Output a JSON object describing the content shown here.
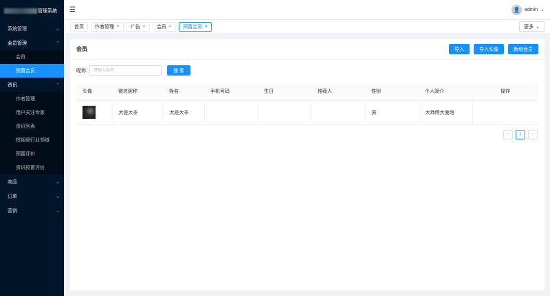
{
  "app": {
    "title_visible": "管理系统"
  },
  "sidebar": {
    "groups": [
      {
        "label": "系统管理",
        "open": false,
        "items": []
      },
      {
        "label": "会员管理",
        "open": true,
        "items": [
          "会员",
          "预置会员"
        ]
      },
      {
        "label": "资讯",
        "open": true,
        "items": [
          "作者管理",
          "用户关注专家",
          "资讯列表",
          "短视频行业领域",
          "预置评价",
          "资讯预置评价"
        ]
      },
      {
        "label": "商品",
        "open": false,
        "items": []
      },
      {
        "label": "订单",
        "open": false,
        "items": []
      },
      {
        "label": "营销",
        "open": false,
        "items": []
      }
    ],
    "active_item": "预置会员"
  },
  "header": {
    "username": "admin"
  },
  "tabs": [
    {
      "label": "首页",
      "closable": false
    },
    {
      "label": "作者管理",
      "closable": true
    },
    {
      "label": "广告",
      "closable": true
    },
    {
      "label": "会员",
      "closable": true
    },
    {
      "label": "预置会员",
      "closable": true,
      "active": true
    }
  ],
  "more_label": "更多",
  "card": {
    "title": "会员",
    "buttons": [
      "导入",
      "导入头像",
      "新增会员"
    ]
  },
  "search": {
    "label": "昵称:",
    "placeholder": "请输入姓名",
    "button": "搜 索"
  },
  "table": {
    "columns": [
      "头像",
      "微信昵称",
      "姓名",
      "手机号码",
      "生日",
      "推荐人",
      "性别",
      "个人简介",
      "操作"
    ],
    "rows": [
      {
        "wechat": "大是大非",
        "name": "大是大非",
        "phone": "",
        "birthday": "",
        "referrer": "",
        "gender": "男",
        "bio": "大师傅大使馆",
        "actions": ""
      }
    ]
  },
  "pagination": {
    "current": "1",
    "prev": "‹",
    "next": "›"
  },
  "colors": {
    "primary": "#1890ff",
    "sidebar": "#001529",
    "submenu": "#000c17"
  }
}
